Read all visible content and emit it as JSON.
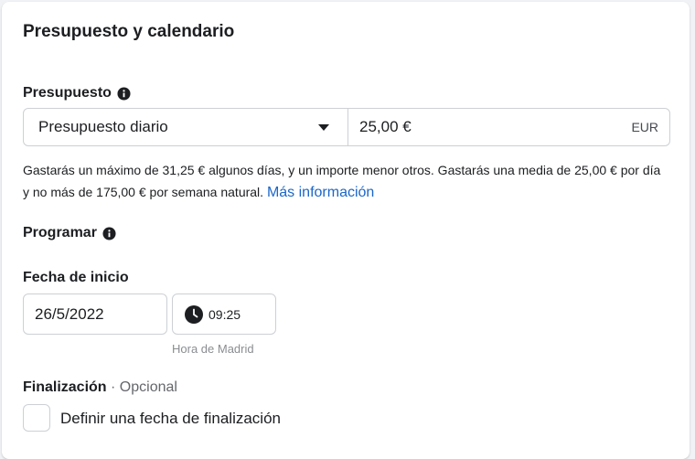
{
  "card": {
    "title": "Presupuesto y calendario"
  },
  "budget": {
    "label": "Presupuesto",
    "type_selected": "Presupuesto diario",
    "amount_value": "25,00 €",
    "currency": "EUR",
    "helper_text": "Gastarás un máximo de 31,25 € algunos días, y un importe menor otros. Gastarás una media de 25,00 € por día y no más de 175,00 € por semana natural. ",
    "more_info_link": "Más información"
  },
  "schedule": {
    "label": "Programar"
  },
  "start_date": {
    "label": "Fecha de inicio",
    "date_value": "26/5/2022",
    "time_value": "09:25",
    "timezone_note": "Hora de Madrid"
  },
  "end": {
    "label": "Finalización",
    "separator": " · ",
    "optional_label": "Opcional",
    "checkbox_label": "Definir una fecha de finalización",
    "checked": false
  },
  "icons": {
    "info": "info-icon",
    "clock": "clock-icon",
    "dropdown": "caret-down-icon"
  },
  "colors": {
    "link": "#1a66c9",
    "border": "#ccd0d5",
    "text": "#1c1e21",
    "muted": "#65676b"
  }
}
